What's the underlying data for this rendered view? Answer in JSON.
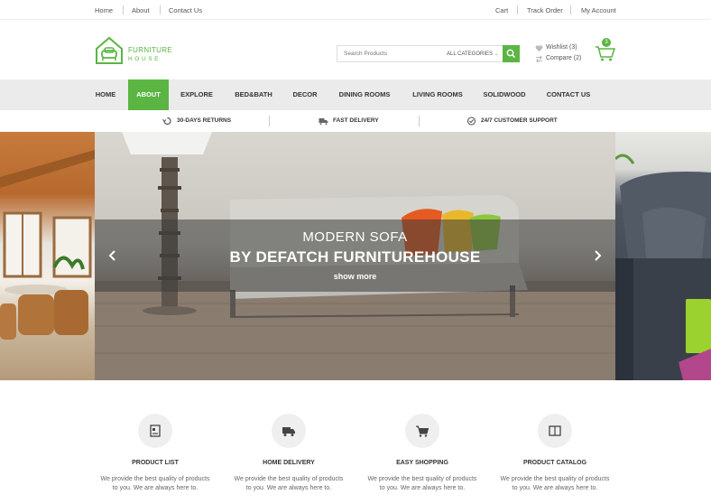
{
  "topbar": {
    "links_left": [
      "Home",
      "About",
      "Contact Us"
    ],
    "links_right": [
      "Cart",
      "Track Order",
      "My Account"
    ]
  },
  "logo": {
    "line1": "FURNITURE",
    "line2": "HOUSE"
  },
  "search": {
    "placeholder": "Search Products",
    "category": "ALL CATEGORIES"
  },
  "wishlist": {
    "label": "Wishlist (3)"
  },
  "compare": {
    "label": "Compare (2)"
  },
  "cart": {
    "count": "3"
  },
  "nav": {
    "items": [
      "HOME",
      "ABOUT",
      "EXPLORE",
      "BED&BATH",
      "DECOR",
      "DINING ROOMS",
      "LIVING ROOMS",
      "SOLIDWOOD",
      "CONTACT US"
    ],
    "active": "ABOUT"
  },
  "features": [
    "30-DAYS RETURNS",
    "FAST DELIVERY",
    "24/7 CUSTOMER SUPPORT"
  ],
  "slider": {
    "line1": "MODERN SOFA",
    "line2": "BY DEFATCH FURNITUREHOUSE",
    "cta": "show more",
    "prev_icon": "chevron-left-icon",
    "next_icon": "chevron-right-icon"
  },
  "services": [
    {
      "title": "PRODUCT LIST",
      "desc1": "We provide the best quality of products",
      "desc2": "to you. We are always here to.",
      "icon": "product-list-icon"
    },
    {
      "title": "HOME DELIVERY",
      "desc1": "We provide the best quality of products",
      "desc2": "to you. We are always here to.",
      "icon": "delivery-truck-icon"
    },
    {
      "title": "EASY SHOPPING",
      "desc1": "We provide the best quality of products",
      "desc2": "to you. We are always here to.",
      "icon": "shopping-cart-icon"
    },
    {
      "title": "PRODUCT CATALOG",
      "desc1": "We provide the best quality of products",
      "desc2": "to you. We are always here to.",
      "icon": "catalog-book-icon"
    }
  ],
  "colors": {
    "accent": "#5bb543",
    "nav_bg": "#ebebeb"
  }
}
